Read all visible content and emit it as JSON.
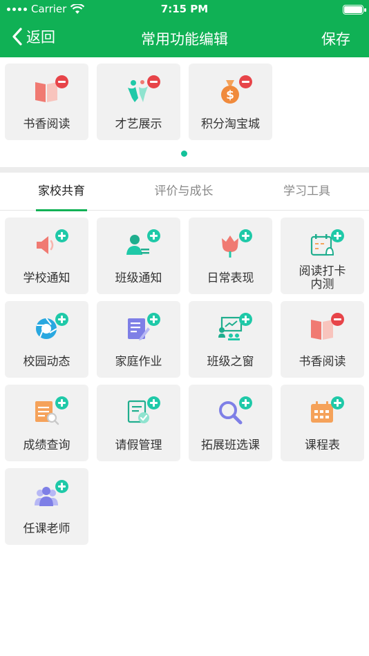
{
  "status_bar": {
    "carrier": "Carrier",
    "time": "7:15 PM"
  },
  "nav": {
    "back_label": "返回",
    "title": "常用功能编辑",
    "save_label": "保存"
  },
  "common_functions": [
    {
      "label": "书香阅读",
      "icon": "book-icon",
      "action": "remove"
    },
    {
      "label": "才艺展示",
      "icon": "talent-icon",
      "action": "remove"
    },
    {
      "label": "积分淘宝城",
      "icon": "money-bag-icon",
      "action": "remove"
    }
  ],
  "pager": {
    "current_page": 1,
    "total_pages": 1
  },
  "tabs": [
    {
      "label": "家校共育",
      "active": true
    },
    {
      "label": "评价与成长",
      "active": false
    },
    {
      "label": "学习工具",
      "active": false
    }
  ],
  "functions": [
    {
      "label": "学校通知",
      "icon": "speaker-icon",
      "action": "add"
    },
    {
      "label": "班级通知",
      "icon": "person-notice-icon",
      "action": "add"
    },
    {
      "label": "日常表现",
      "icon": "tulip-icon",
      "action": "add"
    },
    {
      "label": "阅读打卡\n内测",
      "icon": "calendar-bell-icon",
      "action": "add"
    },
    {
      "label": "校园动态",
      "icon": "aperture-icon",
      "action": "add"
    },
    {
      "label": "家庭作业",
      "icon": "homework-icon",
      "action": "add"
    },
    {
      "label": "班级之窗",
      "icon": "classroom-icon",
      "action": "add"
    },
    {
      "label": "书香阅读",
      "icon": "book-icon",
      "action": "remove"
    },
    {
      "label": "成绩查询",
      "icon": "score-search-icon",
      "action": "add"
    },
    {
      "label": "请假管理",
      "icon": "leave-doc-icon",
      "action": "add"
    },
    {
      "label": "拓展班选课",
      "icon": "magnifier-icon",
      "action": "add"
    },
    {
      "label": "课程表",
      "icon": "schedule-icon",
      "action": "add"
    },
    {
      "label": "任课老师",
      "icon": "teachers-icon",
      "action": "add"
    }
  ],
  "colors": {
    "brand_green": "#10b155",
    "add_badge": "#1fc9a8",
    "remove_badge": "#e74449",
    "tile_bg": "#f1f1f1"
  }
}
